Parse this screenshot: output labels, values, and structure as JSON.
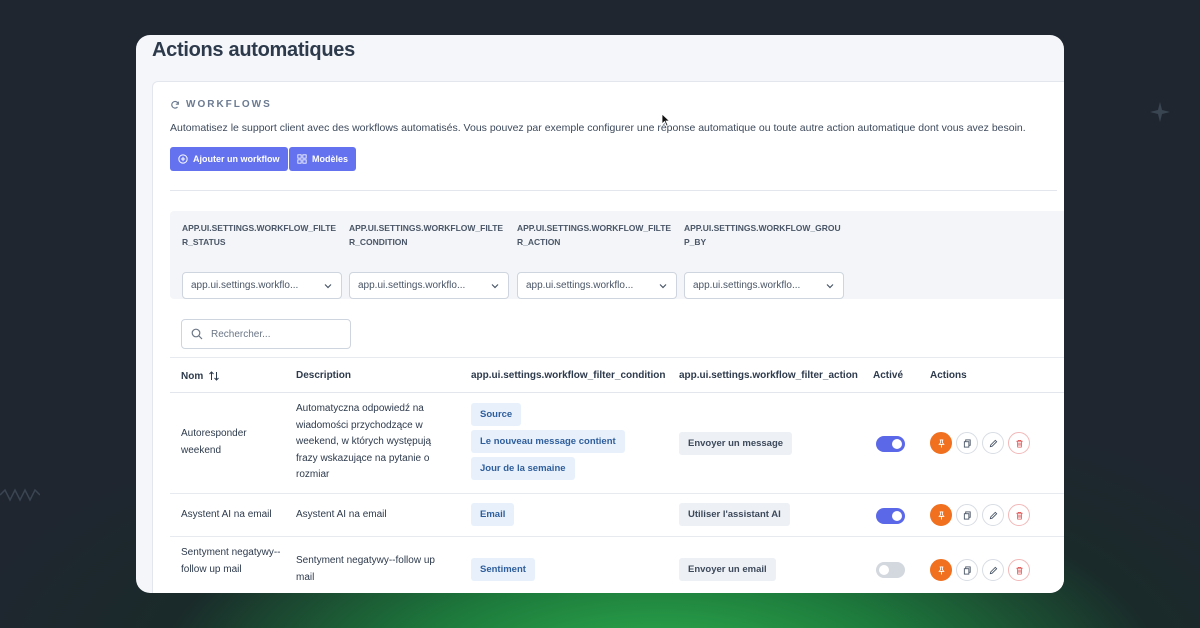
{
  "page": {
    "title": "Actions automatiques"
  },
  "workflows": {
    "section_label": "WORKFLOWS",
    "description": "Automatisez le support client avec des workflows automatisés. Vous pouvez par exemple configurer une réponse automatique ou toute autre action automatique dont vous avez besoin.",
    "add_button": "Ajouter un workflow",
    "models_button": "Modèles"
  },
  "filters": [
    {
      "label": "APP.UI.SETTINGS.WORKFLOW_FILTER_STATUS",
      "value": "app.ui.settings.workflo..."
    },
    {
      "label": "APP.UI.SETTINGS.WORKFLOW_FILTER_CONDITION",
      "value": "app.ui.settings.workflo..."
    },
    {
      "label": "APP.UI.SETTINGS.WORKFLOW_FILTER_ACTION",
      "value": "app.ui.settings.workflo..."
    },
    {
      "label": "APP.UI.SETTINGS.WORKFLOW_GROUP_BY",
      "value": "app.ui.settings.workflo..."
    }
  ],
  "search": {
    "placeholder": "Rechercher..."
  },
  "table": {
    "headers": {
      "name": "Nom",
      "description": "Description",
      "condition": "app.ui.settings.workflow_filter_condition",
      "action": "app.ui.settings.workflow_filter_action",
      "active": "Activé",
      "actions": "Actions"
    },
    "rows": [
      {
        "name": "Autoresponder weekend",
        "description": "Automatyczna odpowiedź na wiadomości przychodzące w weekend, w których występują frazy wskazujące na pytanie o rozmiar",
        "conditions": [
          "Source",
          "Le nouveau message contient",
          "Jour de la semaine"
        ],
        "action": "Envoyer un message",
        "active": true
      },
      {
        "name": "Asystent AI na email",
        "description": "Asystent AI na email",
        "conditions": [
          "Email"
        ],
        "action": "Utiliser l'assistant AI",
        "active": true
      },
      {
        "name": "Sentyment negatywy--follow up mail",
        "description": "Sentyment negatywy--follow up mail",
        "conditions": [
          "Sentiment"
        ],
        "action": "Envoyer un email",
        "active": false
      }
    ]
  },
  "colors": {
    "accent": "#6472f0",
    "toggle_on": "#5b68e8",
    "pin": "#f07020",
    "tag_bg": "#e8f1fb"
  },
  "icons": [
    "refresh-icon",
    "plus-circle-icon",
    "grid-icon",
    "chevron-down-icon",
    "search-icon",
    "sort-icon",
    "pin-icon",
    "copy-icon",
    "edit-icon",
    "trash-icon",
    "cursor-icon"
  ]
}
